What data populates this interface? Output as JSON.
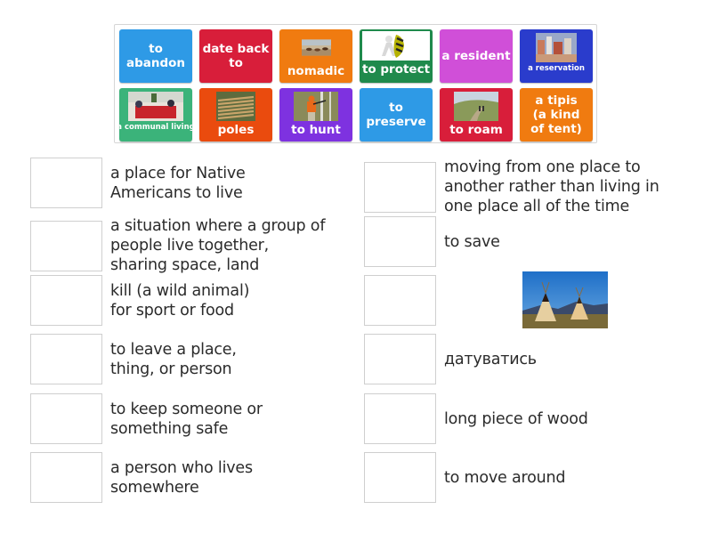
{
  "bank": {
    "tiles": [
      {
        "label": "to abandon",
        "color": "#2e9ae6",
        "image": null
      },
      {
        "label": "date back to",
        "color": "#d81e3a",
        "image": null
      },
      {
        "label": "nomadic",
        "color": "#f07b10",
        "image": "horses-on-steppe"
      },
      {
        "label": "to protect",
        "color": "#1f8a4c",
        "image": "figure-with-shield"
      },
      {
        "label": "a resident",
        "color": "#d04fd8",
        "image": null
      },
      {
        "label": "a reservation",
        "color": "#2a3ccc",
        "image": "crowded-village"
      },
      {
        "label": "a communal living",
        "color": "#3bb37a",
        "image": "people-in-living-room"
      },
      {
        "label": "poles",
        "color": "#ea4b0e",
        "image": "stacked-wooden-poles"
      },
      {
        "label": "to hunt",
        "color": "#7e32e0",
        "image": "hunter-in-forest"
      },
      {
        "label": "to preserve",
        "color": "#2e9ae6",
        "image": null
      },
      {
        "label": "to roam",
        "color": "#d81e3a",
        "image": "hikers-on-hill"
      },
      {
        "label": "a tipis (a kind of tent)",
        "color": "#f07b10",
        "image": null
      }
    ]
  },
  "definitions": {
    "left": [
      {
        "text": "a place for Native Americans to live"
      },
      {
        "text": "a situation where a group of people live together, sharing space, land"
      },
      {
        "text": "kill (a wild animal) for sport or food"
      },
      {
        "text": "to leave a place, thing, or person"
      },
      {
        "text": "to keep someone or something safe"
      },
      {
        "text": "a person who lives somewhere"
      }
    ],
    "right": [
      {
        "text": "moving from one place to another rather than living in one place all of the time"
      },
      {
        "text": "to save"
      },
      {
        "text": "",
        "image": "two-tipis-under-blue-sky"
      },
      {
        "text": "датуватись"
      },
      {
        "text": "long piece of wood"
      },
      {
        "text": "to move around"
      }
    ]
  }
}
